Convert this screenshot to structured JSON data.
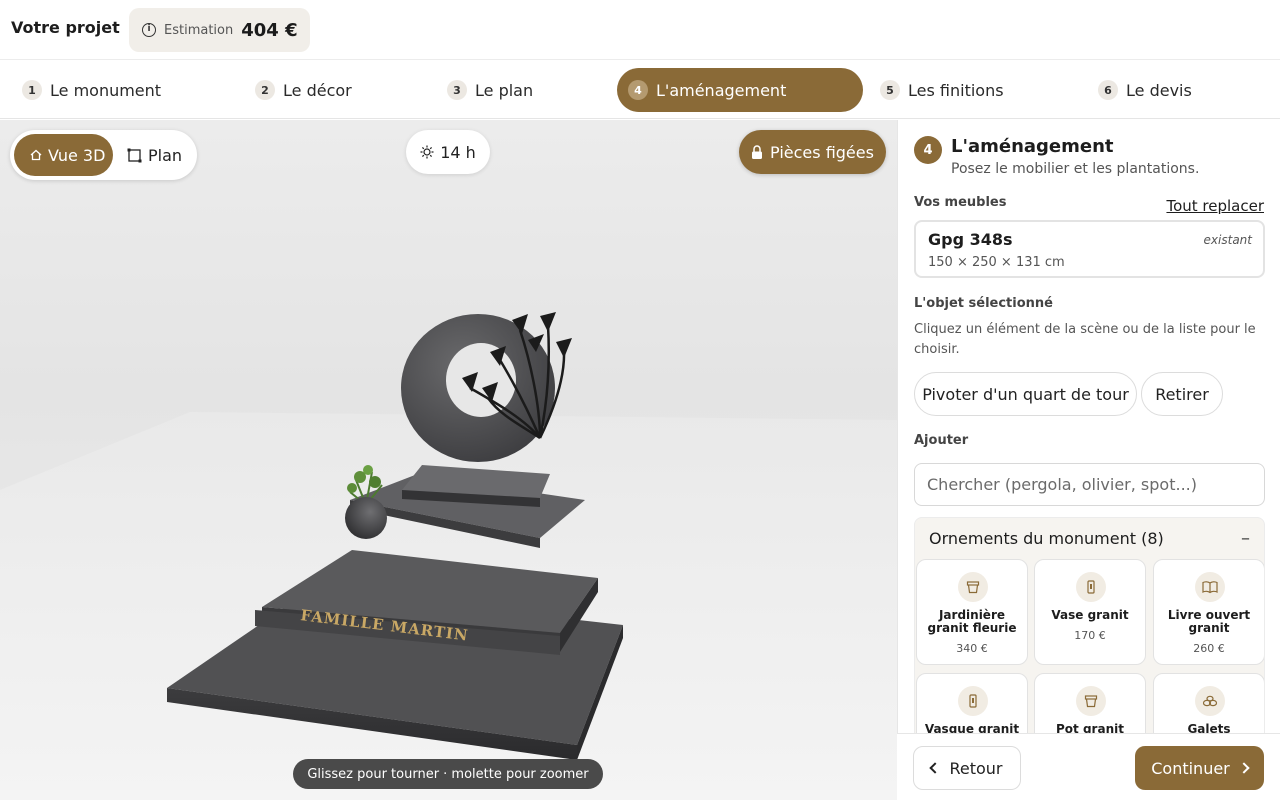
{
  "header": {
    "project_title": "Votre projet",
    "estimate_label": "Estimation",
    "estimate_value": "404 €",
    "info_icon": "i"
  },
  "steps": [
    {
      "num": "1",
      "label": "Le monument",
      "active": false
    },
    {
      "num": "2",
      "label": "Le décor",
      "active": false
    },
    {
      "num": "3",
      "label": "Le plan",
      "active": false
    },
    {
      "num": "4",
      "label": "L'aménagement",
      "active": true
    },
    {
      "num": "5",
      "label": "Les finitions",
      "active": false
    },
    {
      "num": "6",
      "label": "Le devis",
      "active": false
    }
  ],
  "viewport": {
    "view_3d_label": "Vue 3D",
    "plan_label": "Plan",
    "time_label": "14 h",
    "frozen_label": "Pièces figées",
    "hint": "Glissez pour tourner · molette pour zoomer",
    "engraving": "FAMILLE MARTIN"
  },
  "panel": {
    "step_num": "4",
    "title": "L'aménagement",
    "subtitle": "Posez le mobilier et les plantations.",
    "furniture_label": "Vos meubles",
    "replace_all": "Tout replacer",
    "furniture": {
      "name": "Gpg 348s",
      "dims": "150 × 250 × 131 cm",
      "tag": "existant"
    },
    "selected_label": "L'objet sélectionné",
    "selected_text": "Cliquez un élément de la scène ou de la liste pour le choisir.",
    "rotate_label": "Pivoter d'un quart de tour",
    "remove_label": "Retirer",
    "add_label": "Ajouter",
    "search_placeholder": "Chercher (pergola, olivier, spot...)",
    "ornaments_title": "Ornements du monument (8)",
    "collapse_symbol": "–",
    "ornaments": [
      {
        "name": "Jardinière granit fleurie",
        "price": "340 €",
        "icon": "planter-icon"
      },
      {
        "name": "Vase granit",
        "price": "170 €",
        "icon": "vase-icon"
      },
      {
        "name": "Livre ouvert granit",
        "price": "260 €",
        "icon": "book-icon"
      },
      {
        "name": "Vasque granit",
        "price": "",
        "icon": "vase-icon"
      },
      {
        "name": "Pot granit",
        "price": "",
        "icon": "planter-icon"
      },
      {
        "name": "Galets",
        "price": "",
        "icon": "pebbles-icon"
      }
    ],
    "back_label": "Retour",
    "continue_label": "Continuer"
  },
  "colors": {
    "accent": "#8a6a37",
    "accent_light": "#b49a70",
    "granite": "#4a4a4c"
  }
}
